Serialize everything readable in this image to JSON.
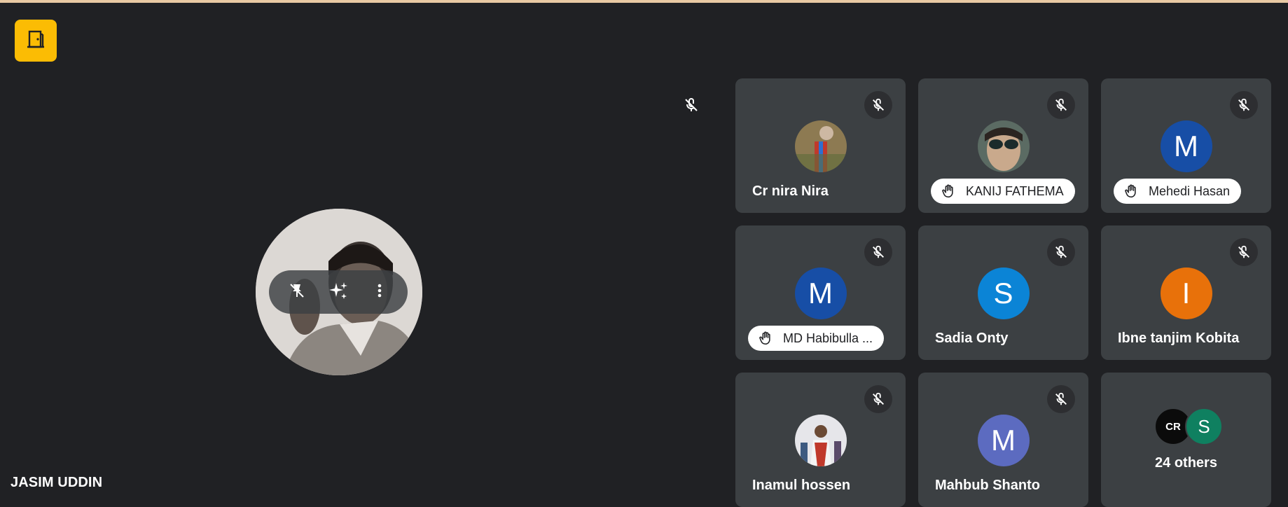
{
  "main": {
    "name": "JASIM UDDIN"
  },
  "tiles": [
    {
      "name": "Cr nira Nira",
      "hand_raised": false
    },
    {
      "name": "KANIJ FATHEMA",
      "hand_raised": true
    },
    {
      "name": "Mehedi Hasan",
      "hand_raised": true,
      "initial": "M"
    },
    {
      "name": "MD Habibulla ...",
      "hand_raised": true,
      "initial": "M"
    },
    {
      "name": "Sadia Onty",
      "hand_raised": false,
      "initial": "S"
    },
    {
      "name": "Ibne tanjim Kobita",
      "hand_raised": false,
      "initial": "I"
    },
    {
      "name": "Inamul hossen",
      "hand_raised": false
    },
    {
      "name": "Mahbub Shanto",
      "hand_raised": false,
      "initial": "M"
    }
  ],
  "others": {
    "avatar1": "CR",
    "avatar2": "S",
    "label": "24 others"
  },
  "colors": {
    "background": "#202124",
    "tile": "#3c4043",
    "leave_button": "#fbbc04",
    "avatar_blue_dark": "#174ea6",
    "avatar_blue": "#1a73e8",
    "avatar_orange": "#e8710a",
    "avatar_indigo": "#5c6bc0",
    "avatar_green": "#0f8060"
  }
}
